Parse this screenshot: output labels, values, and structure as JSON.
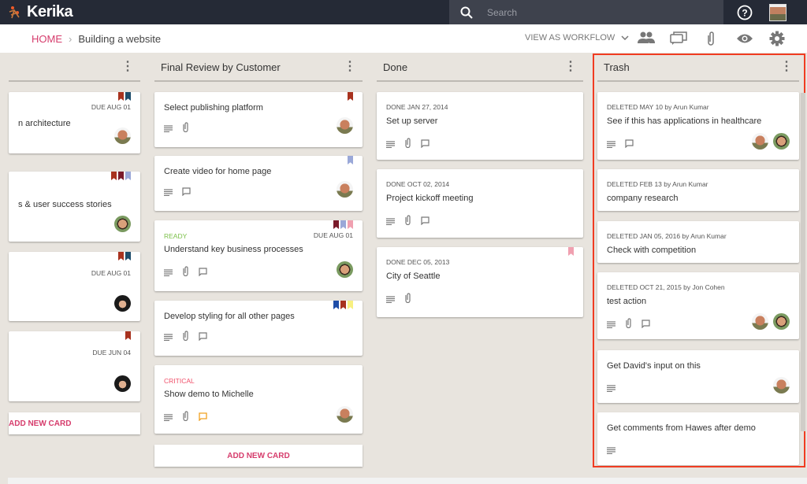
{
  "app": {
    "name": "Kerika"
  },
  "search": {
    "placeholder": "Search"
  },
  "breadcrumb": {
    "home": "HOME",
    "current": "Building a website"
  },
  "toolbar": {
    "view_as": "VIEW AS WORKFLOW"
  },
  "colors": {
    "accent": "#d63c6c",
    "topbar": "#252a36",
    "highlight_box": "#f03c22",
    "ready": "#7cc04a",
    "critical": "#f0506a"
  },
  "columns": [
    {
      "title": "",
      "add_label": "ADD NEW CARD",
      "cards": [
        {
          "due": "DUE AUG 01",
          "title": "n architecture",
          "flags": [
            "#a8321e",
            "#1e4d6b"
          ],
          "icons": [],
          "avatars": [
            "arun"
          ]
        },
        {
          "title": "s & user success stories",
          "flags": [
            "#a8321e",
            "#7a1a2a",
            "#9aa8d8"
          ],
          "icons": [],
          "avatars": [
            "jon"
          ]
        },
        {
          "due": "DUE AUG 01",
          "title": "",
          "flags": [
            "#a8321e",
            "#1e4d6b"
          ],
          "icons": [],
          "avatars": [
            "girl"
          ]
        },
        {
          "due": "DUE JUN 04",
          "title": "",
          "flags": [
            "#a8321e"
          ],
          "icons": [],
          "avatars": [
            "girl"
          ]
        }
      ]
    },
    {
      "title": "Final Review by Customer",
      "add_label": "ADD NEW CARD",
      "cards": [
        {
          "title": "Select publishing platform",
          "flags": [
            "#a8321e"
          ],
          "icons": [
            "description",
            "attachment"
          ],
          "avatars": [
            "arun"
          ]
        },
        {
          "title": "Create video for home page",
          "flags": [
            "#9aa8d8"
          ],
          "icons": [
            "description",
            "chat"
          ],
          "avatars": [
            "arun"
          ]
        },
        {
          "status": "READY",
          "due": "DUE AUG 01",
          "title": "Understand key business processes",
          "flags": [
            "#7a1a2a",
            "#9aa8d8",
            "#f0a0b0"
          ],
          "icons": [
            "description",
            "attachment",
            "chat"
          ],
          "avatars": [
            "jon"
          ]
        },
        {
          "title": "Develop styling for all other pages",
          "flags": [
            "#1e4da8",
            "#a8321e",
            "#f8f080"
          ],
          "icons": [
            "description",
            "attachment",
            "chat"
          ],
          "avatars": []
        },
        {
          "status": "CRITICAL",
          "title": "Show demo to Michelle",
          "flags": [],
          "icons": [
            "description",
            "attachment",
            "chat-orange"
          ],
          "avatars": [
            "arun"
          ]
        }
      ]
    },
    {
      "title": "Done",
      "cards": [
        {
          "meta": "DONE JAN 27, 2014",
          "title": "Set up server",
          "flags": [],
          "icons": [
            "description",
            "attachment",
            "chat"
          ],
          "avatars": []
        },
        {
          "meta": "DONE OCT 02, 2014",
          "title": "Project kickoff meeting",
          "flags": [],
          "icons": [
            "description",
            "attachment",
            "chat"
          ],
          "avatars": []
        },
        {
          "meta": "DONE DEC 05, 2013",
          "title": "City of Seattle",
          "flags": [
            "#f0a0b0"
          ],
          "icons": [
            "description",
            "attachment"
          ],
          "avatars": []
        }
      ]
    },
    {
      "title": "Trash",
      "cards": [
        {
          "meta": "DELETED MAY 10 by Arun Kumar",
          "title": "See if this has applications in healthcare",
          "flags": [],
          "icons": [
            "description",
            "chat"
          ],
          "avatars": [
            "arun",
            "jon"
          ]
        },
        {
          "meta": "DELETED FEB 13 by Arun Kumar",
          "title": "company research",
          "flags": [],
          "icons": [],
          "avatars": []
        },
        {
          "meta": "DELETED JAN 05, 2016 by Arun Kumar",
          "title": "Check with competition",
          "flags": [],
          "icons": [],
          "avatars": []
        },
        {
          "meta": "DELETED OCT 21, 2015 by Jon Cohen",
          "title": "test action",
          "flags": [],
          "icons": [
            "description",
            "attachment",
            "chat"
          ],
          "avatars": [
            "arun",
            "jon"
          ]
        },
        {
          "title": "Get David's input on this",
          "flags": [],
          "icons": [
            "description"
          ],
          "avatars": [
            "arun"
          ]
        },
        {
          "title": "Get comments from Hawes after demo",
          "flags": [],
          "icons": [
            "description"
          ],
          "avatars": []
        }
      ]
    }
  ]
}
